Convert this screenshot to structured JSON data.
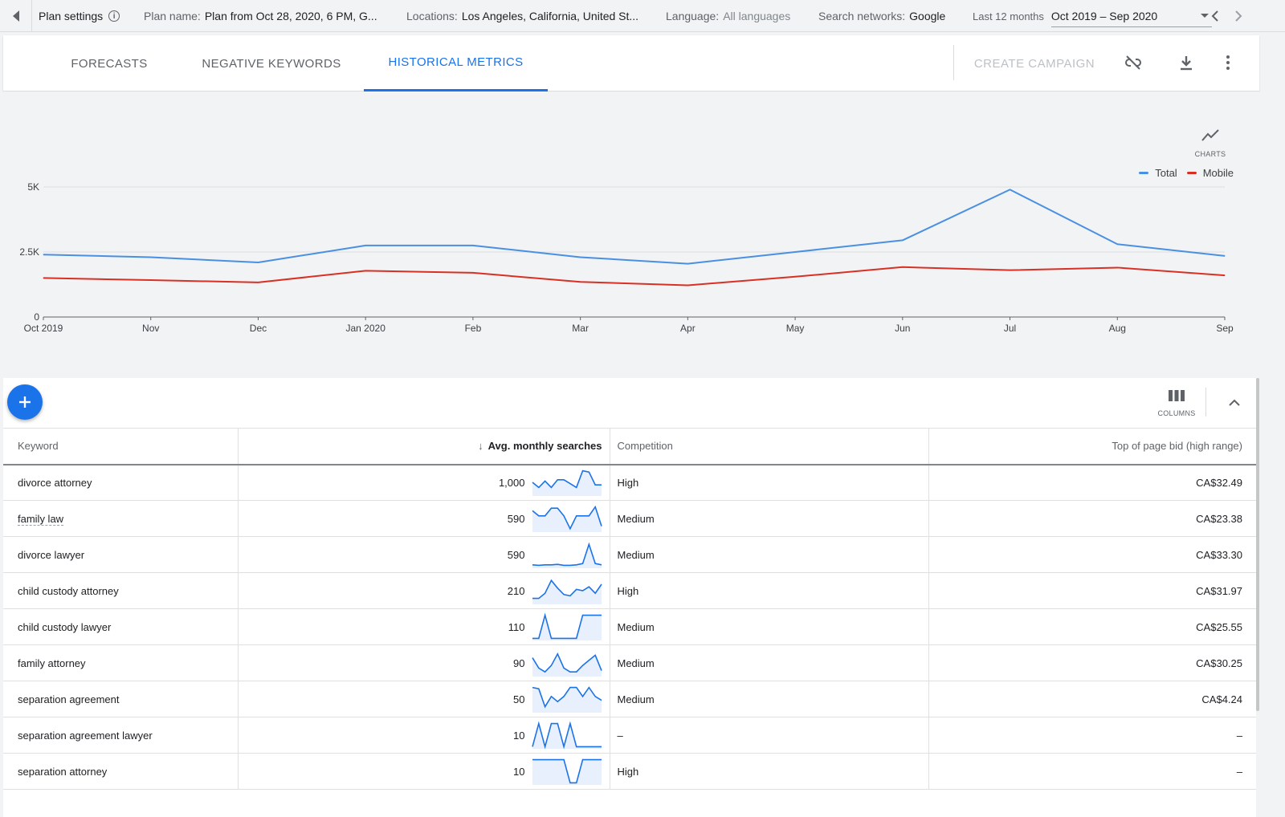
{
  "topbar": {
    "plan_settings": "Plan settings",
    "plan_name_label": "Plan name:",
    "plan_name_value": "Plan from Oct 28, 2020, 6 PM, G...",
    "locations_label": "Locations:",
    "locations_value": "Los Angeles, California, United St...",
    "language_label": "Language:",
    "language_value": "All languages",
    "networks_label": "Search networks:",
    "networks_value": "Google",
    "range_label": "Last 12 months",
    "range_value": "Oct 2019 – Sep 2020"
  },
  "tabs": [
    {
      "label": "FORECASTS"
    },
    {
      "label": "NEGATIVE KEYWORDS"
    },
    {
      "label": "HISTORICAL METRICS"
    }
  ],
  "toolbar": {
    "create_campaign": "CREATE CAMPAIGN",
    "charts_label": "CHARTS",
    "columns_label": "COLUMNS"
  },
  "colors": {
    "accent": "#1a73e8",
    "total": "#4a90e2",
    "mobile": "#d93025"
  },
  "chart_data": {
    "type": "line",
    "categories": [
      "Oct 2019",
      "Nov",
      "Dec",
      "Jan 2020",
      "Feb",
      "Mar",
      "Apr",
      "May",
      "Jun",
      "Jul",
      "Aug",
      "Sep"
    ],
    "series": [
      {
        "name": "Total",
        "color": "#4a90e2",
        "values": [
          2400,
          2300,
          2100,
          2750,
          2750,
          2300,
          2050,
          2500,
          2950,
          4900,
          2800,
          2350
        ]
      },
      {
        "name": "Mobile",
        "color": "#d93025",
        "values": [
          1500,
          1420,
          1330,
          1780,
          1700,
          1350,
          1220,
          1550,
          1920,
          1800,
          1900,
          1600
        ]
      }
    ],
    "yticks": [
      "0",
      "2.5K",
      "5K"
    ],
    "ylim": [
      0,
      5000
    ],
    "grid": true,
    "legend": "top-right"
  },
  "table": {
    "headers": {
      "keyword": "Keyword",
      "avg": "Avg. monthly searches",
      "competition": "Competition",
      "bid": "Top of page bid (high range)"
    },
    "rows": [
      {
        "keyword": "divorce attorney",
        "avg": "1,000",
        "competition": "High",
        "bid": "CA$32.49",
        "trend": [
          50,
          30,
          55,
          30,
          60,
          60,
          45,
          30,
          95,
          90,
          40,
          40
        ]
      },
      {
        "keyword": "family law",
        "avg": "590",
        "competition": "Medium",
        "bid": "CA$23.38",
        "trend": [
          80,
          60,
          60,
          90,
          90,
          60,
          10,
          60,
          60,
          60,
          95,
          20
        ]
      },
      {
        "keyword": "divorce lawyer",
        "avg": "590",
        "competition": "Medium",
        "bid": "CA$33.30",
        "trend": [
          10,
          8,
          10,
          10,
          12,
          8,
          8,
          10,
          15,
          90,
          15,
          10
        ]
      },
      {
        "keyword": "child custody attorney",
        "avg": "210",
        "competition": "High",
        "bid": "CA$31.97",
        "trend": [
          20,
          20,
          40,
          90,
          60,
          35,
          30,
          55,
          50,
          65,
          40,
          75
        ]
      },
      {
        "keyword": "child custody lawyer",
        "avg": "110",
        "competition": "Medium",
        "bid": "CA$25.55",
        "trend": [
          5,
          5,
          95,
          5,
          5,
          5,
          5,
          5,
          95,
          95,
          95,
          95
        ]
      },
      {
        "keyword": "family attorney",
        "avg": "90",
        "competition": "Medium",
        "bid": "CA$30.25",
        "trend": [
          70,
          30,
          15,
          40,
          85,
          30,
          15,
          15,
          40,
          60,
          80,
          20
        ]
      },
      {
        "keyword": "separation agreement",
        "avg": "50",
        "competition": "Medium",
        "bid": "CA$4.24",
        "trend": [
          95,
          90,
          20,
          60,
          40,
          60,
          95,
          95,
          60,
          95,
          60,
          45
        ]
      },
      {
        "keyword": "separation agreement lawyer",
        "avg": "10",
        "competition": "–",
        "bid": "–",
        "trend": [
          5,
          95,
          5,
          95,
          95,
          5,
          95,
          5,
          5,
          5,
          5,
          5
        ]
      },
      {
        "keyword": "separation attorney",
        "avg": "10",
        "competition": "High",
        "bid": "–",
        "trend": [
          95,
          95,
          95,
          95,
          95,
          95,
          5,
          5,
          95,
          95,
          95,
          95
        ]
      }
    ]
  }
}
